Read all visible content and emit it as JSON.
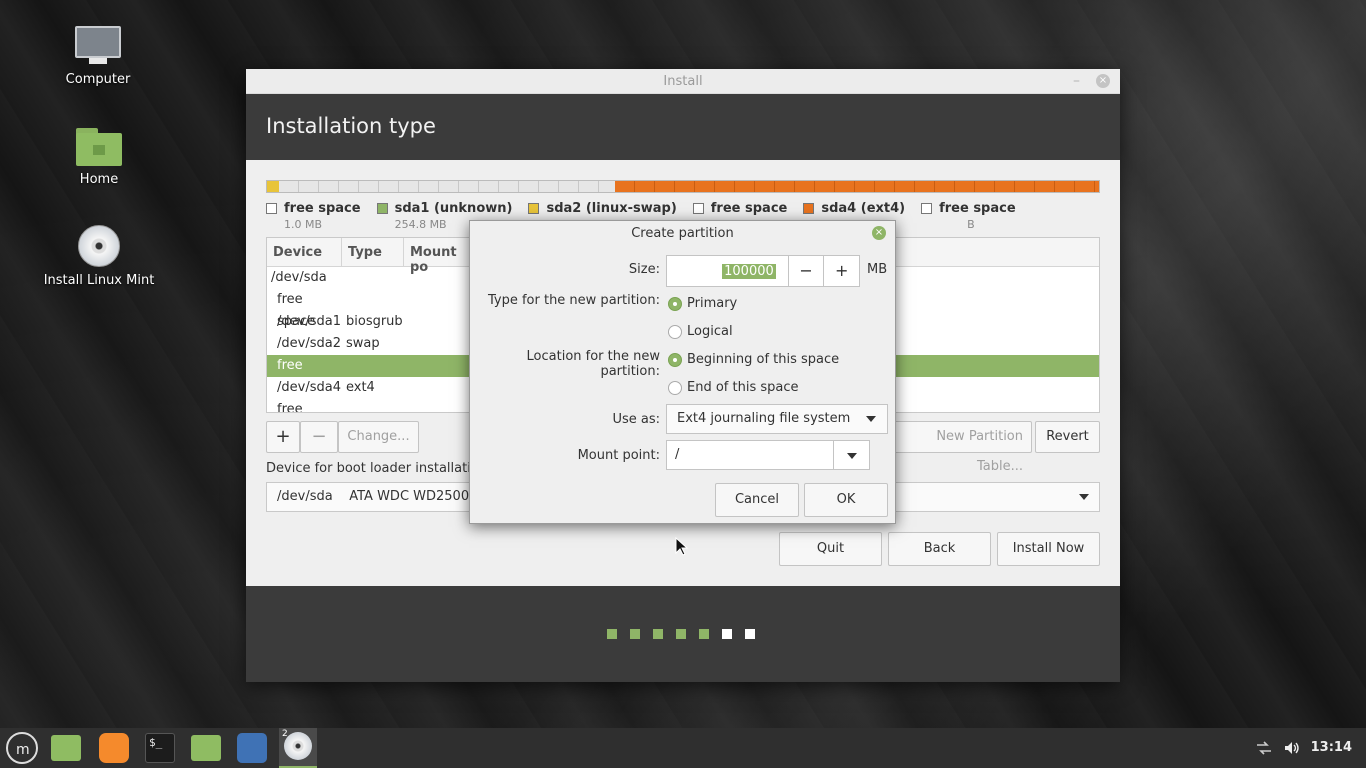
{
  "desktop": {
    "icons": [
      {
        "label": "Computer",
        "icon": "computer-icon"
      },
      {
        "label": "Home",
        "icon": "home-folder-icon"
      },
      {
        "label": "Install Linux Mint",
        "icon": "disc-icon"
      }
    ]
  },
  "window": {
    "title": "Install",
    "minimize": "–",
    "close": "×",
    "header_title": "Installation type",
    "legend": [
      {
        "label": "free space",
        "size": "1.0 MB",
        "color": "#ffffff"
      },
      {
        "label": "sda1 (unknown)",
        "size": "254.8 MB",
        "color": "#8fb567"
      },
      {
        "label": "sda2 (linux-swap)",
        "size": "",
        "color": "#e8c43a"
      },
      {
        "label": "free space",
        "size": "",
        "color": "#ffffff"
      },
      {
        "label": "sda4 (ext4)",
        "size": "",
        "color": "#e8731f"
      },
      {
        "label": "free space",
        "size": "B",
        "color": "#ffffff"
      }
    ],
    "table": {
      "headers": [
        "Device",
        "Type",
        "Mount po"
      ],
      "rows": [
        {
          "device": "/dev/sda",
          "type": ""
        },
        {
          "device": "free space",
          "type": ""
        },
        {
          "device": "/dev/sda1",
          "type": "biosgrub"
        },
        {
          "device": "/dev/sda2",
          "type": "swap"
        },
        {
          "device": "free space",
          "type": "",
          "selected": true
        },
        {
          "device": "/dev/sda4",
          "type": "ext4"
        },
        {
          "device": "free space",
          "type": ""
        }
      ]
    },
    "buttons": {
      "add": "+",
      "remove": "−",
      "change": "Change...",
      "new_table": "New Partition Table...",
      "revert": "Revert",
      "quit": "Quit",
      "back": "Back",
      "install_now": "Install Now"
    },
    "bootloader": {
      "label": "Device for boot loader installation",
      "device": "/dev/sda",
      "model": "ATA WDC WD2500AA"
    },
    "progress": {
      "total": 7,
      "completed": 5,
      "accent": "#8fb567"
    }
  },
  "dialog": {
    "title": "Create partition",
    "close": "×",
    "size_label": "Size:",
    "size_value": "100000",
    "minus": "−",
    "plus": "+",
    "size_unit": "MB",
    "type_label": "Type for the new partition:",
    "type_options": [
      "Primary",
      "Logical"
    ],
    "type_selected": "Primary",
    "location_label": "Location for the new partition:",
    "location_options": [
      "Beginning of this space",
      "End of this space"
    ],
    "location_selected": "Beginning of this space",
    "use_as_label": "Use as:",
    "use_as_value": "Ext4 journaling file system",
    "mount_label": "Mount point:",
    "mount_value": "/",
    "cancel": "Cancel",
    "ok": "OK"
  },
  "taskbar": {
    "workspace_badge": "2",
    "apps": [
      "mint-menu-icon",
      "files-icon",
      "firefox-icon",
      "terminal-icon",
      "folder-icon",
      "screenshot-icon",
      "installer-icon"
    ],
    "clock": "13:14"
  }
}
